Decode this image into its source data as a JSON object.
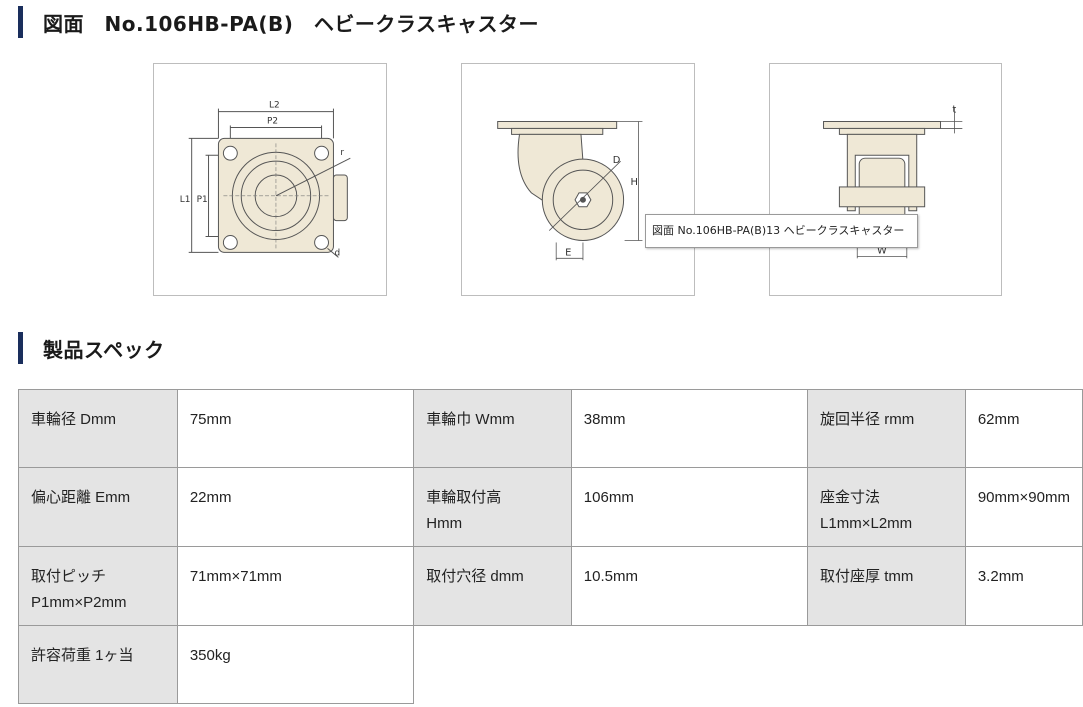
{
  "drawing_section": {
    "title": "図面　No.106HB-PA(B)　ヘビークラスキャスター",
    "tooltip": "図面 No.106HB-PA(B)13 ヘビークラスキャスター",
    "fig1_labels": {
      "l2": "L2",
      "p2": "P2",
      "l1": "L1",
      "p1": "P1",
      "r": "r",
      "d": "d"
    },
    "fig2_labels": {
      "d": "D",
      "h": "H",
      "e": "E"
    },
    "fig3_labels": {
      "t": "t",
      "w": "W"
    }
  },
  "spec_section": {
    "title": "製品スペック",
    "rows": [
      [
        {
          "label": "車輪径 Dmm",
          "value": "75mm"
        },
        {
          "label": "車輪巾 Wmm",
          "value": "38mm"
        },
        {
          "label": "旋回半径 rmm",
          "value": "62mm"
        }
      ],
      [
        {
          "label": "偏心距離 Emm",
          "value": "22mm"
        },
        {
          "label": "車輪取付高",
          "label2": "Hmm",
          "value": "106mm"
        },
        {
          "label": "座金寸法",
          "label2": "L1mm×L2mm",
          "value": "90mm×90mm"
        }
      ],
      [
        {
          "label": "取付ピッチ",
          "label2": "P1mm×P2mm",
          "value": "71mm×71mm"
        },
        {
          "label": "取付穴径 dmm",
          "value": "10.5mm"
        },
        {
          "label": "取付座厚 tmm",
          "value": "3.2mm"
        }
      ],
      [
        {
          "label": "許容荷重 1ヶ当",
          "value": "350kg"
        }
      ]
    ]
  },
  "colors": {
    "accent_bar": "#1a2e5c",
    "label_cell_bg": "#e4e4e4",
    "drawing_fill": "#efe8d6"
  }
}
